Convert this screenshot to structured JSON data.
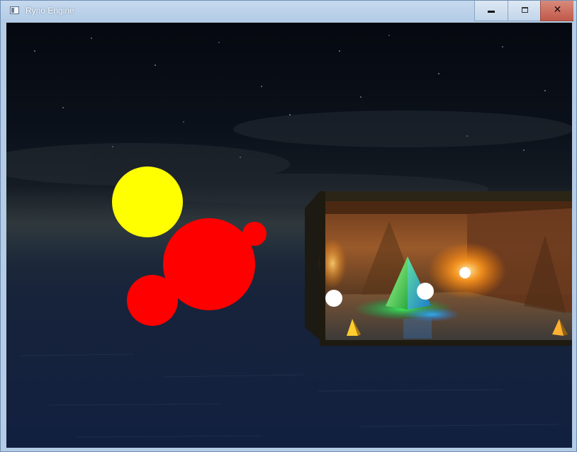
{
  "window": {
    "title": "Ryno Engine",
    "minimize_icon": "minimize-icon",
    "maximize_icon": "maximize-icon",
    "close_icon": "close-icon",
    "close_glyph": "✕"
  },
  "scene": {
    "sky_colors": [
      "#05080f",
      "#151b22",
      "#242b32"
    ],
    "water_colors": [
      "#1f2a38",
      "#122040"
    ],
    "sphere_colors": {
      "yellow": "#ffff00",
      "red": "#ff0000",
      "white": "#ffffff"
    },
    "room_colors": {
      "wall": "#8a4a22",
      "floor": "#5c4632",
      "light": "#ffb030",
      "pyramid": "#44e06a"
    }
  }
}
